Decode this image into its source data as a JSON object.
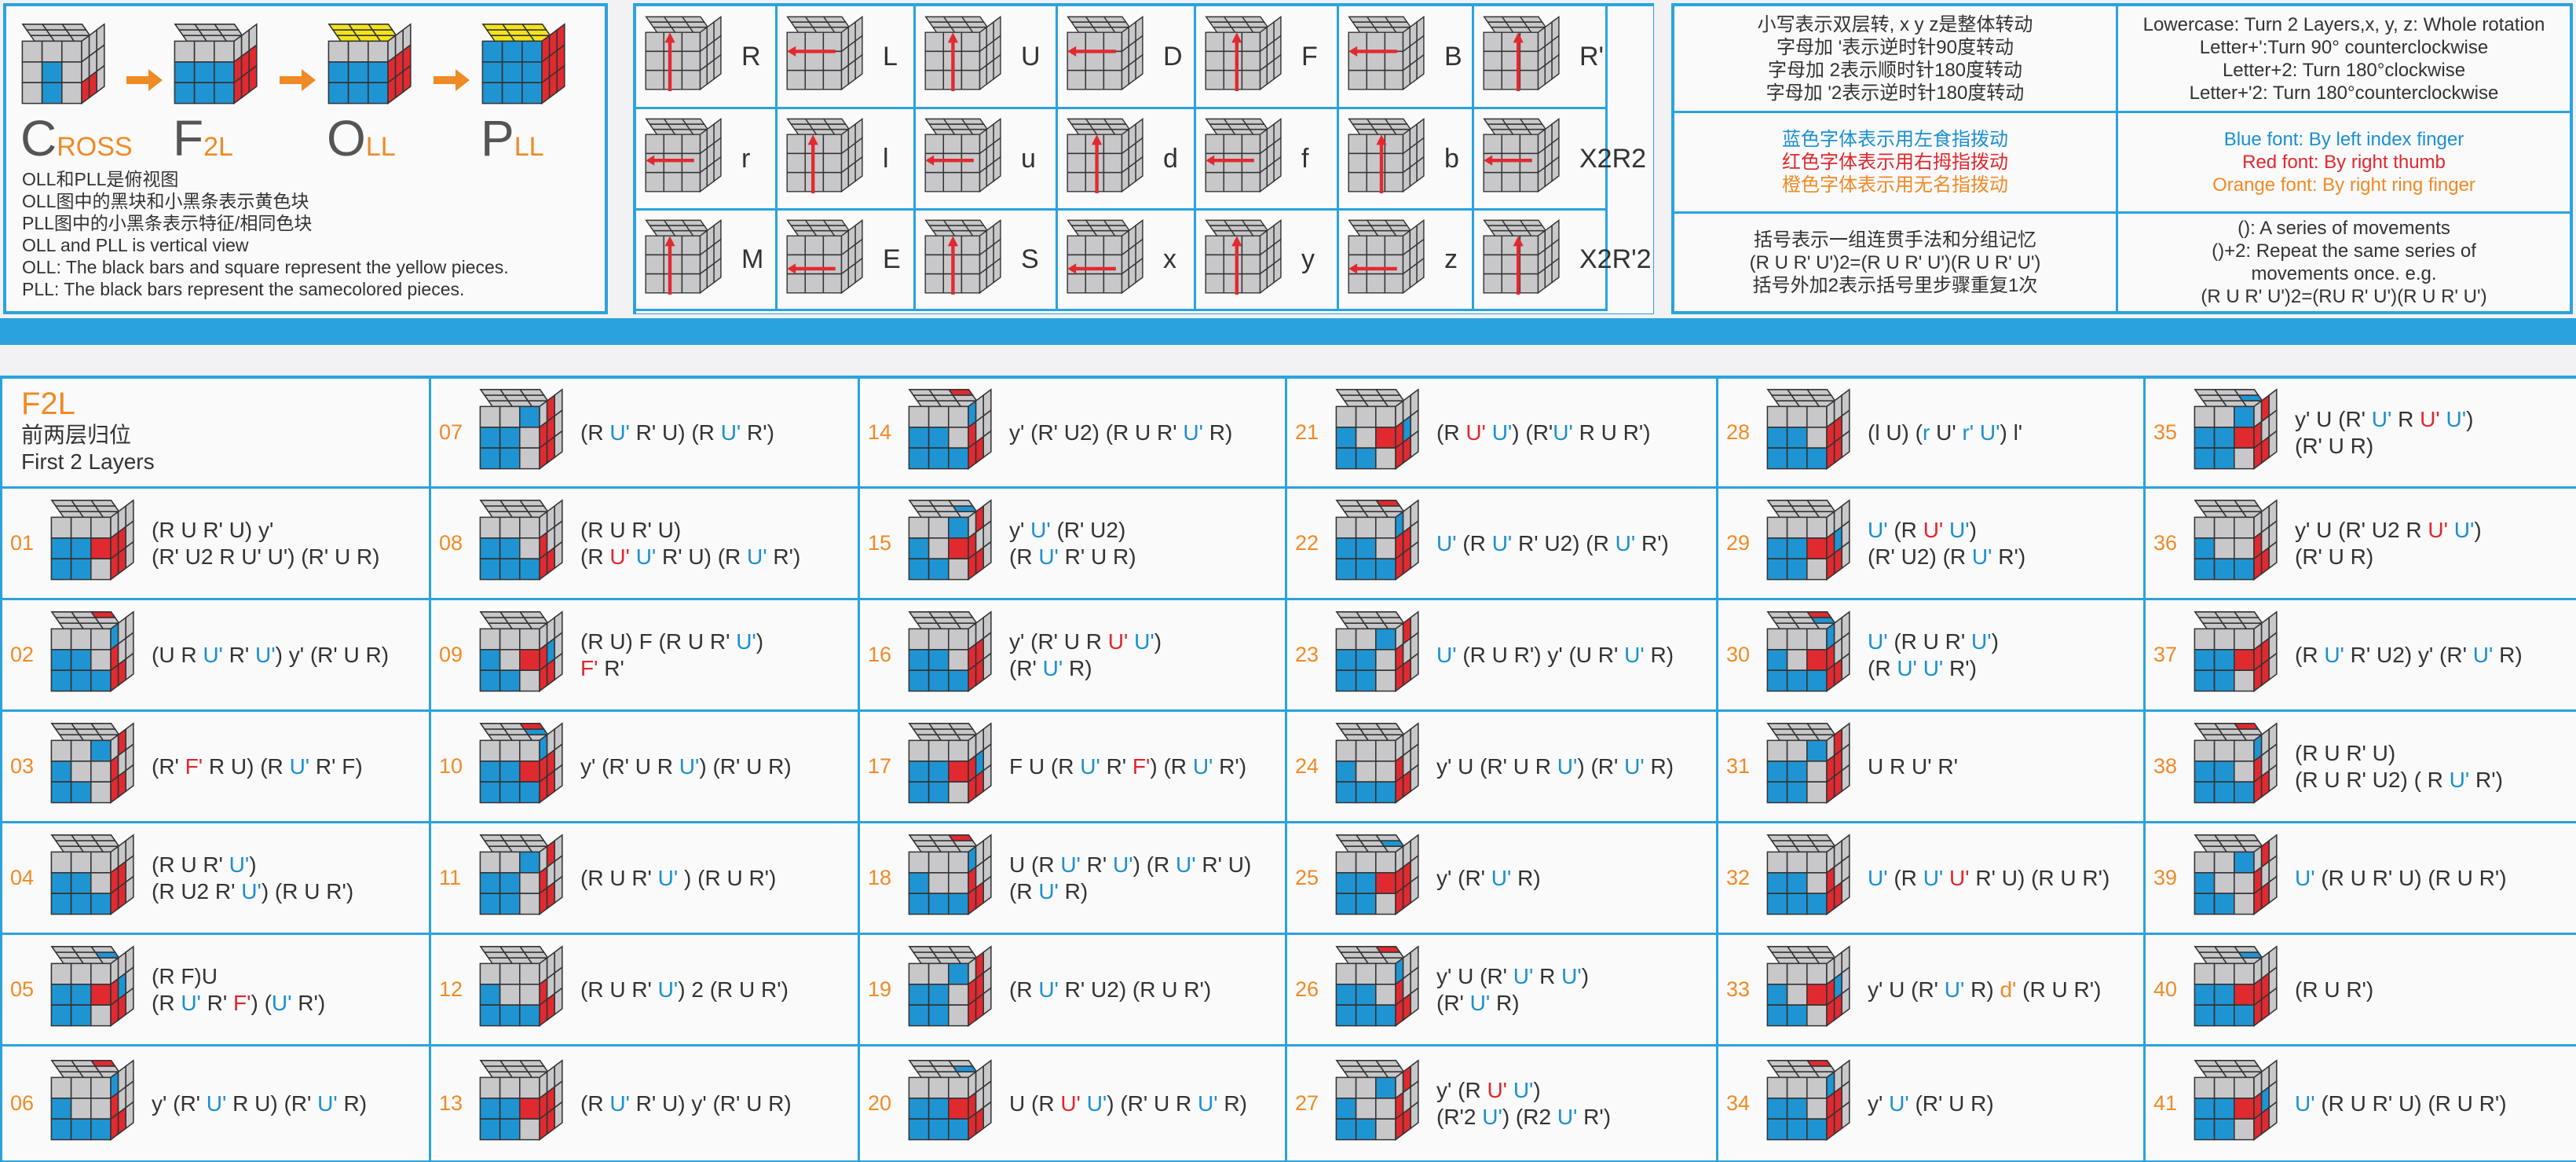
{
  "colors": {
    "accent": "#2aa3dc",
    "blue_move": "#1a8fd0",
    "red_move": "#e1262c",
    "orange_move": "#f08a24",
    "cube_blue": "#1f94d2",
    "cube_red": "#e02a30",
    "cube_yellow": "#f5e31a",
    "cube_gray": "#c8c8ca"
  },
  "steps": [
    {
      "big": "C",
      "small": "ROSS"
    },
    {
      "big": "F",
      "small": "2L"
    },
    {
      "big": "O",
      "small": "LL"
    },
    {
      "big": "P",
      "small": "LL"
    }
  ],
  "notes": [
    "OLL和PLL是俯视图",
    "OLL图中的黑块和小黑条表示黄色块",
    "PLL图中的小黑条表示特征/相同色块",
    "OLL and PLL is vertical view",
    "OLL: The black bars and square represent the yellow pieces.",
    "PLL: The black bars represent the samecolored pieces."
  ],
  "notation": [
    [
      "R",
      "L",
      "U",
      "D",
      "F",
      "B",
      "R'"
    ],
    [
      "r",
      "l",
      "u",
      "d",
      "f",
      "b",
      "X2R2"
    ],
    [
      "M",
      "E",
      "S",
      "x",
      "y",
      "z",
      "X2R'2"
    ]
  ],
  "desc": {
    "r0_zh": [
      "小写表示双层转, x y z是整体转动",
      "字母加 '表示逆时针90度转动",
      "字母加 2表示顺时针180度转动",
      "字母加 '2表示逆时针180度转动"
    ],
    "r0_en": [
      "Lowercase: Turn 2 Layers,x, y, z: Whole rotation",
      "Letter+':Turn  90° counterclockwise",
      "Letter+2: Turn 180°clockwise",
      "Letter+'2: Turn 180°counterclockwise"
    ],
    "r1_zh": [
      "蓝色字体表示用左食指拨动",
      "红色字体表示用右拇指拨动",
      "橙色字体表示用无名指拨动"
    ],
    "r1_en": [
      "Blue font:  By left index finger",
      "Red font:  By right thumb",
      "Orange font:  By right  ring finger"
    ],
    "r2_zh": [
      "括号表示一组连贯手法和分组记忆",
      "(R U R' U')2=(R U R' U')(R U R' U')",
      "括号外加2表示括号里步骤重复1次"
    ],
    "r2_en": [
      "(): A series of movements",
      "()+2: Repeat the same series of",
      "movements  once. e.g.",
      "(R U R' U')2=(RU R' U')(R U R' U')"
    ]
  },
  "f2l": {
    "title": "F2L",
    "subtitle_zh": "前两层归位",
    "subtitle_en": "First 2 Layers"
  },
  "cases": [
    {
      "n": "01",
      "l": [
        [
          [
            "(R U R' U) y'",
            ""
          ]
        ],
        [
          [
            "(R' U2 R ",
            ""
          ],
          [
            "U' U'",
            "m"
          ],
          [
            ") (R' U R)",
            ""
          ]
        ]
      ]
    },
    {
      "n": "02",
      "l": [
        [
          [
            "(U R ",
            ""
          ],
          [
            "U'",
            "b"
          ],
          [
            " R' ",
            ""
          ],
          [
            "U'",
            "b"
          ],
          [
            ") y' (R' U R)",
            ""
          ]
        ]
      ]
    },
    {
      "n": "03",
      "l": [
        [
          [
            "(R' ",
            ""
          ],
          [
            "F'",
            "r"
          ],
          [
            " R U) (R ",
            ""
          ],
          [
            "U'",
            "b"
          ],
          [
            " R' F)",
            ""
          ]
        ]
      ]
    },
    {
      "n": "04",
      "l": [
        [
          [
            "(R U R' ",
            ""
          ],
          [
            "U'",
            "b"
          ],
          [
            ")",
            ""
          ]
        ],
        [
          [
            "(R U2 R' ",
            ""
          ],
          [
            "U'",
            "b"
          ],
          [
            ") (R U R')",
            ""
          ]
        ]
      ]
    },
    {
      "n": "05",
      "l": [
        [
          [
            "(R F)U",
            ""
          ]
        ],
        [
          [
            "(R ",
            ""
          ],
          [
            "U'",
            "b"
          ],
          [
            " R' ",
            ""
          ],
          [
            "F'",
            "r"
          ],
          [
            ") (",
            ""
          ],
          [
            "U'",
            "b"
          ],
          [
            " R')",
            ""
          ]
        ]
      ]
    },
    {
      "n": "06",
      "l": [
        [
          [
            "y' (R' ",
            ""
          ],
          [
            "U'",
            "b"
          ],
          [
            " R U) (R' ",
            ""
          ],
          [
            "U'",
            "b"
          ],
          [
            " R)",
            ""
          ]
        ]
      ]
    },
    {
      "n": "07",
      "l": [
        [
          [
            "(R ",
            ""
          ],
          [
            "U'",
            "b"
          ],
          [
            " R' U) (R ",
            ""
          ],
          [
            "U'",
            "b"
          ],
          [
            " R')",
            ""
          ]
        ]
      ]
    },
    {
      "n": "08",
      "l": [
        [
          [
            "(R U R' U)",
            ""
          ]
        ],
        [
          [
            "(R ",
            ""
          ],
          [
            "U'",
            "r"
          ],
          [
            " ",
            ""
          ],
          [
            "U'",
            "b"
          ],
          [
            " R' U) (R ",
            ""
          ],
          [
            "U'",
            "b"
          ],
          [
            " R')",
            ""
          ]
        ]
      ]
    },
    {
      "n": "09",
      "l": [
        [
          [
            "(R U) F (R U R' ",
            ""
          ],
          [
            "U'",
            "b"
          ],
          [
            ")",
            ""
          ]
        ],
        [
          [
            "F'",
            "r"
          ],
          [
            " R'",
            ""
          ]
        ]
      ]
    },
    {
      "n": "10",
      "l": [
        [
          [
            "y' (R' U R ",
            ""
          ],
          [
            "U'",
            "b"
          ],
          [
            ") (R' U R)",
            ""
          ]
        ]
      ]
    },
    {
      "n": "11",
      "l": [
        [
          [
            "(R U R' ",
            ""
          ],
          [
            "U'",
            "b"
          ],
          [
            " ) (R U R')",
            ""
          ]
        ]
      ]
    },
    {
      "n": "12",
      "l": [
        [
          [
            "(R U R' ",
            ""
          ],
          [
            "U'",
            "b"
          ],
          [
            ") 2 (R U R')",
            ""
          ]
        ]
      ]
    },
    {
      "n": "13",
      "l": [
        [
          [
            "(R ",
            ""
          ],
          [
            "U'",
            "b"
          ],
          [
            " R' U) y' (R' U R)",
            ""
          ]
        ]
      ]
    },
    {
      "n": "14",
      "l": [
        [
          [
            "y' (R' U2) (R U R' ",
            ""
          ],
          [
            "U'",
            "b"
          ],
          [
            " R)",
            ""
          ]
        ]
      ]
    },
    {
      "n": "15",
      "l": [
        [
          [
            "y' ",
            ""
          ],
          [
            "U'",
            "b"
          ],
          [
            " (R' U2)",
            ""
          ]
        ],
        [
          [
            "(R ",
            ""
          ],
          [
            "U'",
            "b"
          ],
          [
            " R' U R)",
            ""
          ]
        ]
      ]
    },
    {
      "n": "16",
      "l": [
        [
          [
            "y' (R' U R ",
            ""
          ],
          [
            "U'",
            "r"
          ],
          [
            " ",
            ""
          ],
          [
            "U'",
            "b"
          ],
          [
            ")",
            ""
          ]
        ],
        [
          [
            "(R' ",
            ""
          ],
          [
            "U'",
            "b"
          ],
          [
            " R)",
            ""
          ]
        ]
      ]
    },
    {
      "n": "17",
      "l": [
        [
          [
            "F U (R ",
            ""
          ],
          [
            "U'",
            "b"
          ],
          [
            " R' ",
            ""
          ],
          [
            "F'",
            "r"
          ],
          [
            ") (R ",
            ""
          ],
          [
            "U'",
            "b"
          ],
          [
            " R')",
            ""
          ]
        ]
      ]
    },
    {
      "n": "18",
      "l": [
        [
          [
            "U (R ",
            ""
          ],
          [
            "U'",
            "b"
          ],
          [
            " R' ",
            ""
          ],
          [
            "U'",
            "b"
          ],
          [
            ") (R ",
            ""
          ],
          [
            "U'",
            "b"
          ],
          [
            " R' U)",
            ""
          ]
        ],
        [
          [
            "(R ",
            ""
          ],
          [
            "U'",
            "b"
          ],
          [
            " R)",
            ""
          ]
        ]
      ]
    },
    {
      "n": "19",
      "l": [
        [
          [
            "(R ",
            ""
          ],
          [
            "U'",
            "b"
          ],
          [
            " R' U2) (R U R')",
            ""
          ]
        ]
      ]
    },
    {
      "n": "20",
      "l": [
        [
          [
            "U (R ",
            ""
          ],
          [
            "U'",
            "r"
          ],
          [
            " ",
            ""
          ],
          [
            "U'",
            "b"
          ],
          [
            ") (R' U R ",
            ""
          ],
          [
            "U'",
            "b"
          ],
          [
            " R)",
            ""
          ]
        ]
      ]
    },
    {
      "n": "21",
      "l": [
        [
          [
            "(R ",
            ""
          ],
          [
            "U'",
            "r"
          ],
          [
            " ",
            ""
          ],
          [
            "U'",
            "b"
          ],
          [
            ") (R'",
            ""
          ],
          [
            "U'",
            "b"
          ],
          [
            " R U R')",
            ""
          ]
        ]
      ]
    },
    {
      "n": "22",
      "l": [
        [
          [
            "U'",
            "b"
          ],
          [
            " (R ",
            ""
          ],
          [
            "U'",
            "b"
          ],
          [
            " R' U2) (R ",
            ""
          ],
          [
            "U'",
            "b"
          ],
          [
            " R')",
            ""
          ]
        ]
      ]
    },
    {
      "n": "23",
      "l": [
        [
          [
            "U'",
            "b"
          ],
          [
            " (R U R') y' (U R' ",
            ""
          ],
          [
            "U'",
            "b"
          ],
          [
            " R)",
            ""
          ]
        ]
      ]
    },
    {
      "n": "24",
      "l": [
        [
          [
            "y' U (R' U R ",
            ""
          ],
          [
            "U'",
            "b"
          ],
          [
            ") (R' ",
            ""
          ],
          [
            "U'",
            "b"
          ],
          [
            " R)",
            ""
          ]
        ]
      ]
    },
    {
      "n": "25",
      "l": [
        [
          [
            "y' (R' ",
            ""
          ],
          [
            "U'",
            "b"
          ],
          [
            " R)",
            ""
          ]
        ]
      ]
    },
    {
      "n": "26",
      "l": [
        [
          [
            "y' U (R' ",
            ""
          ],
          [
            "U'",
            "b"
          ],
          [
            " R ",
            ""
          ],
          [
            "U'",
            "b"
          ],
          [
            ")",
            ""
          ]
        ],
        [
          [
            "(R' ",
            ""
          ],
          [
            "U'",
            "b"
          ],
          [
            " R)",
            ""
          ]
        ]
      ]
    },
    {
      "n": "27",
      "l": [
        [
          [
            "y' (R ",
            ""
          ],
          [
            "U'",
            "r"
          ],
          [
            " ",
            ""
          ],
          [
            "U'",
            "b"
          ],
          [
            ")",
            ""
          ]
        ],
        [
          [
            "(R'2 ",
            ""
          ],
          [
            "U'",
            "b"
          ],
          [
            ") (R2 ",
            ""
          ],
          [
            "U'",
            "b"
          ],
          [
            " R')",
            ""
          ]
        ]
      ]
    },
    {
      "n": "28",
      "l": [
        [
          [
            "(l U) (",
            ""
          ],
          [
            "r",
            "b"
          ],
          [
            " U' ",
            ""
          ],
          [
            "r'",
            "b"
          ],
          [
            " ",
            ""
          ],
          [
            "U'",
            "b"
          ],
          [
            ") l'",
            ""
          ]
        ]
      ]
    },
    {
      "n": "29",
      "l": [
        [
          [
            "U'",
            "b"
          ],
          [
            " (R ",
            ""
          ],
          [
            "U'",
            "r"
          ],
          [
            " ",
            ""
          ],
          [
            "U'",
            "b"
          ],
          [
            ")",
            ""
          ]
        ],
        [
          [
            "(R' U2) (R ",
            ""
          ],
          [
            "U'",
            "b"
          ],
          [
            " R')",
            ""
          ]
        ]
      ]
    },
    {
      "n": "30",
      "l": [
        [
          [
            "U'",
            "b"
          ],
          [
            " (R U R' ",
            ""
          ],
          [
            "U'",
            "b"
          ],
          [
            ")",
            ""
          ]
        ],
        [
          [
            "(R ",
            ""
          ],
          [
            "U'",
            "b"
          ],
          [
            " ",
            ""
          ],
          [
            "U'",
            "b"
          ],
          [
            " R')",
            ""
          ]
        ]
      ]
    },
    {
      "n": "31",
      "l": [
        [
          [
            "U R U' R'",
            ""
          ]
        ]
      ]
    },
    {
      "n": "32",
      "l": [
        [
          [
            "U'",
            "b"
          ],
          [
            " (R ",
            ""
          ],
          [
            "U'",
            "b"
          ],
          [
            " ",
            ""
          ],
          [
            "U'",
            "r"
          ],
          [
            " R' U) (R U R')",
            ""
          ]
        ]
      ]
    },
    {
      "n": "33",
      "l": [
        [
          [
            "y' U (R' ",
            ""
          ],
          [
            "U'",
            "b"
          ],
          [
            " R) ",
            ""
          ],
          [
            "d'",
            "o"
          ],
          [
            " (R U R')",
            ""
          ]
        ]
      ]
    },
    {
      "n": "34",
      "l": [
        [
          [
            "y' ",
            ""
          ],
          [
            "U'",
            "b"
          ],
          [
            " (R' U R)",
            ""
          ]
        ]
      ]
    },
    {
      "n": "35",
      "l": [
        [
          [
            "y' U (R' ",
            ""
          ],
          [
            "U'",
            "b"
          ],
          [
            " R ",
            ""
          ],
          [
            "U'",
            "r"
          ],
          [
            " ",
            ""
          ],
          [
            "U'",
            "b"
          ],
          [
            ")",
            ""
          ]
        ],
        [
          [
            "(R' U R)",
            ""
          ]
        ]
      ]
    },
    {
      "n": "36",
      "l": [
        [
          [
            "y' U (R' U2 R ",
            ""
          ],
          [
            "U'",
            "r"
          ],
          [
            " ",
            ""
          ],
          [
            "U'",
            "b"
          ],
          [
            ")",
            ""
          ]
        ],
        [
          [
            "(R' U R)",
            ""
          ]
        ]
      ]
    },
    {
      "n": "37",
      "l": [
        [
          [
            "(R ",
            ""
          ],
          [
            "U'",
            "b"
          ],
          [
            " R' U2) y' (R' ",
            ""
          ],
          [
            "U'",
            "b"
          ],
          [
            " R)",
            ""
          ]
        ]
      ]
    },
    {
      "n": "38",
      "l": [
        [
          [
            "(R U R' U)",
            ""
          ]
        ],
        [
          [
            "(R U R' U2) ( R ",
            ""
          ],
          [
            "U'",
            "b"
          ],
          [
            " R')",
            ""
          ]
        ]
      ]
    },
    {
      "n": "39",
      "l": [
        [
          [
            "U'",
            "b"
          ],
          [
            " (R U R' U) (R U R')",
            ""
          ]
        ]
      ]
    },
    {
      "n": "40",
      "l": [
        [
          [
            "(R U R')",
            ""
          ]
        ]
      ]
    },
    {
      "n": "41",
      "l": [
        [
          [
            "U'",
            "b"
          ],
          [
            "  (R U R' U) (R U R')",
            ""
          ]
        ]
      ]
    }
  ]
}
